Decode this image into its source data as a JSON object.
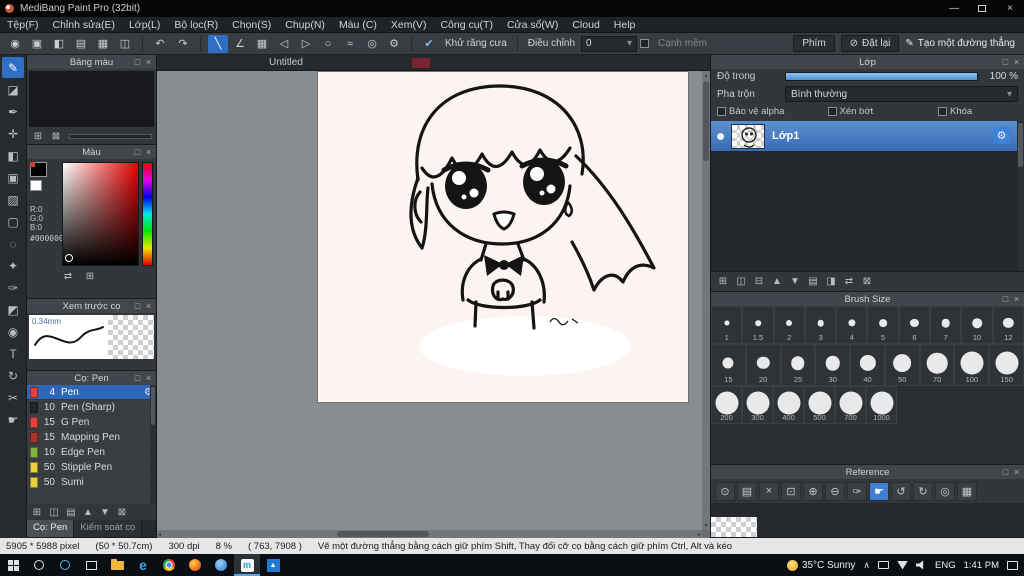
{
  "window": {
    "title": "MediBang Paint Pro (32bit)"
  },
  "icons": {
    "minimize": "—",
    "close": "×",
    "popout": "□",
    "caret": "▾",
    "undo": "↶",
    "redo": "↷",
    "pen": "✎",
    "no": "⊘",
    "check": "✔",
    "gear": "⚙",
    "left": "◂",
    "right": "▸",
    "up": "▴",
    "down": "▾",
    "swap": "⇄",
    "add": "⊞",
    "trash": "⊠"
  },
  "menu": {
    "items": [
      "Tệp(F)",
      "Chỉnh sửa(E)",
      "Lớp(L)",
      "Bộ lọc(R)",
      "Chọn(S)",
      "Chụp(N)",
      "Màu (C)",
      "Xem(V)",
      "Công cụ(T)",
      "Cửa sổ(W)",
      "Cloud",
      "Help"
    ]
  },
  "toolbar": {
    "left_icons": [
      {
        "name": "pan-icon",
        "glyph": "◉"
      },
      {
        "name": "save-icon",
        "glyph": "▣"
      },
      {
        "name": "comment-icon",
        "glyph": "◧"
      },
      {
        "name": "pages-icon",
        "glyph": "▤"
      },
      {
        "name": "grid-view-icon",
        "glyph": "▦"
      },
      {
        "name": "layout-icon",
        "glyph": "◫"
      }
    ],
    "shape_icons": [
      {
        "name": "line-tool",
        "glyph": "╲",
        "selected": true
      },
      {
        "name": "polyline-tool",
        "glyph": "∠"
      },
      {
        "name": "grid-tool",
        "glyph": "▦"
      },
      {
        "name": "angle-left-tool",
        "glyph": "◁"
      },
      {
        "name": "angle-right-tool",
        "glyph": "▷"
      },
      {
        "name": "ellipse-tool",
        "glyph": "○"
      },
      {
        "name": "curve-tool",
        "glyph": "≈"
      },
      {
        "name": "snap-center-tool",
        "glyph": "◎"
      },
      {
        "name": "snap-settings-icon",
        "glyph": "⚙"
      }
    ],
    "antialias": "Khử răng cưa",
    "adjust_label": "Điều chỉnh",
    "adjust_value": "0",
    "soft_edge": "Cạnh mềm",
    "key_button": "Phím",
    "reset_button": "Đặt lại",
    "tool_name": "Tạo một đường thẳng"
  },
  "left_tools": [
    {
      "name": "brush-tool",
      "glyph": "✎",
      "selected": true
    },
    {
      "name": "eraser-tool",
      "glyph": "◪"
    },
    {
      "name": "pen-tool",
      "glyph": "✒"
    },
    {
      "name": "move-tool",
      "glyph": "✛"
    },
    {
      "name": "fill-tool",
      "glyph": "◧"
    },
    {
      "name": "bucket-tool",
      "glyph": "▣"
    },
    {
      "name": "gradient-tool",
      "glyph": "▨"
    },
    {
      "name": "select-rect-tool",
      "glyph": "▢"
    },
    {
      "name": "lasso-tool",
      "glyph": "◌"
    },
    {
      "name": "magic-wand-tool",
      "glyph": "✦"
    },
    {
      "name": "select-pen-tool",
      "glyph": "✑"
    },
    {
      "name": "select-eraser-tool",
      "glyph": "◩"
    },
    {
      "name": "eyedropper-tool",
      "glyph": "◉"
    },
    {
      "name": "text-tool",
      "glyph": "T"
    },
    {
      "name": "rotate-tool",
      "glyph": "↻"
    },
    {
      "name": "divide-tool",
      "glyph": "✂"
    },
    {
      "name": "hand-tool",
      "glyph": "☛"
    }
  ],
  "panels": {
    "palette": {
      "title": "Bảng màu"
    },
    "color": {
      "title": "Màu",
      "r": "R:0",
      "g": "G:0",
      "b": "B:0",
      "hex": "#000000"
    },
    "preview": {
      "title": "Xem trước cọ",
      "size": "0.34mm"
    },
    "brushes": {
      "title": "Cọ: Pen",
      "items": [
        {
          "size": "4",
          "name": "Pen",
          "color": "#e8413c",
          "selected": true
        },
        {
          "size": "10",
          "name": "Pen (Sharp)",
          "color": "#23262a"
        },
        {
          "size": "15",
          "name": "G Pen",
          "color": "#e8413c"
        },
        {
          "size": "15",
          "name": "Mapping Pen",
          "color": "#a8322c"
        },
        {
          "size": "10",
          "name": "Edge Pen",
          "color": "#7fb33a"
        },
        {
          "size": "50",
          "name": "Stipple Pen",
          "color": "#e8d23c"
        },
        {
          "size": "50",
          "name": "Sumi",
          "color": "#e8d23c"
        }
      ],
      "footer_icons": [
        {
          "name": "add-brush-icon",
          "glyph": "⊞"
        },
        {
          "name": "duplicate-brush-icon",
          "glyph": "◫"
        },
        {
          "name": "brush-folder-icon",
          "glyph": "▤"
        },
        {
          "name": "brush-up-icon",
          "glyph": "▲"
        },
        {
          "name": "brush-down-icon",
          "glyph": "▼"
        },
        {
          "name": "delete-brush-icon",
          "glyph": "⊠"
        }
      ],
      "tabs": [
        {
          "label": "Cọ: Pen",
          "active": true
        },
        {
          "label": "Kiểm soát cọ",
          "active": false
        }
      ]
    },
    "layer": {
      "title": "Lớp",
      "opacity_label": "Độ trong",
      "opacity_value": "100 %",
      "blend_label": "Pha trộn",
      "blend_value": "Bình thường",
      "checkboxes": [
        "Bảo vệ alpha",
        "Xén bớt",
        "Khóa"
      ],
      "layer_name": "Lớp1",
      "action_icons": [
        {
          "name": "add-layer-icon",
          "glyph": "⊞"
        },
        {
          "name": "duplicate-layer-icon",
          "glyph": "◫"
        },
        {
          "name": "merge-layer-icon",
          "glyph": "⊟"
        },
        {
          "name": "layer-up-icon",
          "glyph": "▲"
        },
        {
          "name": "layer-down-icon",
          "glyph": "▼"
        },
        {
          "name": "layer-folder-icon",
          "glyph": "▤"
        },
        {
          "name": "clip-layer-icon",
          "glyph": "◨"
        },
        {
          "name": "transfer-layer-icon",
          "glyph": "⇄"
        },
        {
          "name": "delete-layer-icon",
          "glyph": "⊠"
        }
      ]
    },
    "brush_size": {
      "title": "Brush Size",
      "rows": [
        [
          "1",
          "1.5",
          "2",
          "3",
          "4",
          "5",
          "6",
          "7",
          "10",
          "12"
        ],
        [
          "15",
          "20",
          "25",
          "30",
          "40",
          "50",
          "70",
          "100",
          "150"
        ],
        [
          "200",
          "300",
          "400",
          "500",
          "700",
          "1000"
        ]
      ]
    },
    "reference": {
      "title": "Reference",
      "icons": [
        {
          "name": "pin-icon",
          "glyph": "⊙"
        },
        {
          "name": "open-reference-icon",
          "glyph": "▤"
        },
        {
          "name": "close-reference-icon",
          "glyph": "×"
        },
        {
          "name": "fit-view-icon",
          "glyph": "⊡"
        },
        {
          "name": "zoom-in-icon",
          "glyph": "⊕"
        },
        {
          "name": "zoom-out-icon",
          "glyph": "⊖"
        },
        {
          "name": "eyedropper-icon",
          "glyph": "✑"
        },
        {
          "name": "hand-icon",
          "glyph": "☛",
          "selected": true
        },
        {
          "name": "rotate-ccw-icon",
          "glyph": "↺"
        },
        {
          "name": "rotate-cw-icon",
          "glyph": "↻"
        },
        {
          "name": "target-icon",
          "glyph": "◎"
        },
        {
          "name": "grid-icon",
          "glyph": "▦"
        }
      ]
    }
  },
  "canvas": {
    "tab": "Untitled"
  },
  "statusbar": {
    "size": "5905 * 5988 pixel",
    "cm": "(50 * 50.7cm)",
    "dpi": "300 dpi",
    "zoom": "8 %",
    "coords": "( 763, 7908 )",
    "hint": "Vẽ một đường thẳng bằng cách giữ phím Shift, Thay đổi cỡ cọ bằng cách giữ phím Ctrl, Alt và kéo"
  },
  "taskbar": {
    "weather": "35°C Sunny",
    "lang": "ENG",
    "time": "1:41 PM",
    "apps": [
      {
        "name": "start-button",
        "kind": "start"
      },
      {
        "name": "search-button",
        "kind": "search"
      },
      {
        "name": "cortana-button",
        "kind": "cortana"
      },
      {
        "name": "task-view-button",
        "kind": "taskview"
      },
      {
        "name": "file-explorer-icon",
        "kind": "explorer"
      },
      {
        "name": "edge-icon",
        "kind": "edge",
        "glyph": "e"
      },
      {
        "name": "chrome-icon",
        "kind": "chrome"
      },
      {
        "name": "firefox-icon",
        "kind": "firefox"
      },
      {
        "name": "browser-icon",
        "kind": "chrome2"
      },
      {
        "name": "medibang-taskbar-icon",
        "kind": "medibang",
        "glyph": "m",
        "active": true
      },
      {
        "name": "photos-icon",
        "kind": "photos",
        "glyph": "▲"
      }
    ]
  }
}
